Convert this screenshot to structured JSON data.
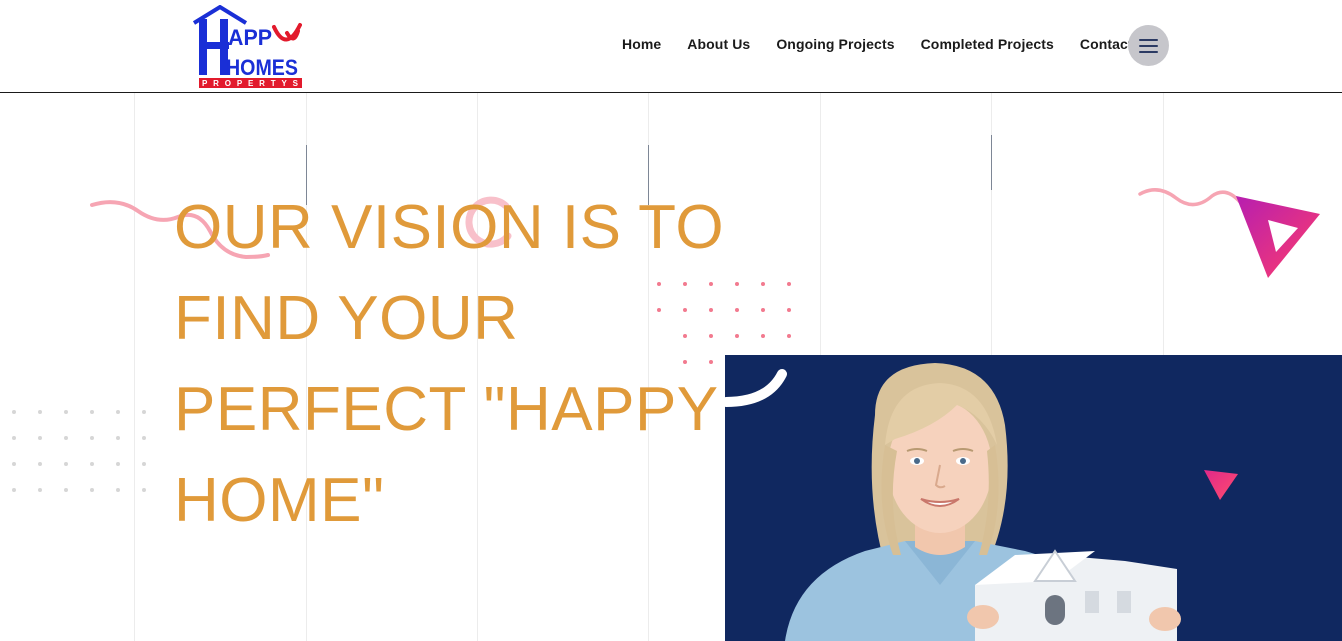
{
  "brand": {
    "logo_lines": [
      "APP",
      "HOMES",
      "PROPERTYS"
    ],
    "logo_initial": "H",
    "colors": {
      "blue": "#1a2fd6",
      "red": "#e21a2c",
      "white": "#ffffff"
    }
  },
  "nav": {
    "items": [
      {
        "label": "Home"
      },
      {
        "label": "About Us"
      },
      {
        "label": "Ongoing Projects"
      },
      {
        "label": "Completed Projects"
      },
      {
        "label": "Contact"
      }
    ],
    "menu_icon": "hamburger-icon"
  },
  "hero": {
    "heading": "OUR VISION IS TO FIND YOUR PERFECT \"HAPPY HOME\"",
    "heading_color": "#e09a3a",
    "image_background": "#102860",
    "image_subject": "woman-holding-house-model"
  },
  "colors": {
    "accent_pink": "#f27a8f",
    "accent_magenta": "#e6237a",
    "grid_line": "#ececec"
  }
}
